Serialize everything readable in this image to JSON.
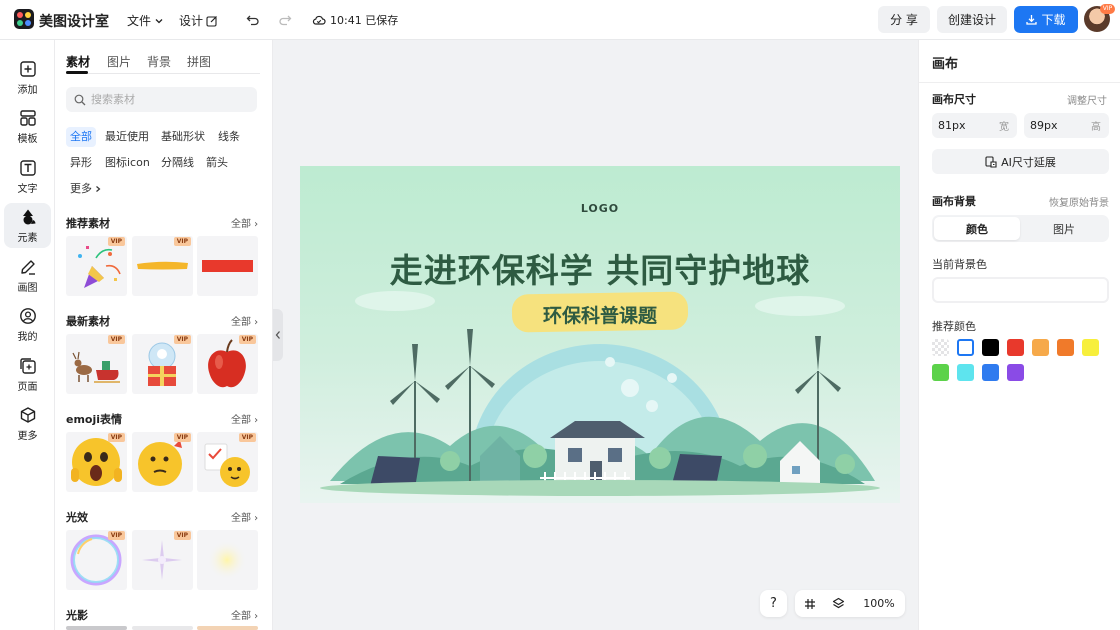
{
  "header": {
    "brand": "美图设计室",
    "menu_file": "文件",
    "menu_design": "设计",
    "save_time": "10:41 已保存",
    "share_label": "分 享",
    "create_label": "创建设计",
    "download_label": "下载",
    "avatar_badge": "VIP",
    "accent_color": "#1d77f3"
  },
  "rail": [
    {
      "label": "添加",
      "icon": "plus-square-icon"
    },
    {
      "label": "模板",
      "icon": "template-icon"
    },
    {
      "label": "文字",
      "icon": "text-icon"
    },
    {
      "label": "元素",
      "icon": "shapes-icon",
      "active": true
    },
    {
      "label": "画图",
      "icon": "draw-icon"
    },
    {
      "label": "我的",
      "icon": "user-icon"
    },
    {
      "label": "页面",
      "icon": "page-add-icon"
    },
    {
      "label": "更多",
      "icon": "cube-icon"
    }
  ],
  "panel": {
    "tabs": [
      "素材",
      "图片",
      "背景",
      "拼图"
    ],
    "active_tab": "素材",
    "search_placeholder": "搜索素材",
    "chips": [
      "全部",
      "最近使用",
      "基础形状",
      "线条",
      "异形",
      "图标icon",
      "分隔线",
      "箭头",
      "更多"
    ],
    "active_chip": "全部",
    "sections": [
      {
        "title": "推荐素材",
        "more": "全部"
      },
      {
        "title": "最新素材",
        "more": "全部"
      },
      {
        "title": "emoji表情",
        "more": "全部"
      },
      {
        "title": "光效",
        "more": "全部"
      },
      {
        "title": "光影",
        "more": "全部"
      }
    ],
    "vip_label": "VIP"
  },
  "canvas": {
    "logo_text": "LOGO",
    "title": "走进环保科学 共同守护地球",
    "subtitle": "环保科普课题",
    "zoom": "100%",
    "help": "?"
  },
  "props": {
    "title": "画布",
    "size_label": "画布尺寸",
    "resize_link": "调整尺寸",
    "width_value": "81px",
    "width_unit": "宽",
    "height_value": "89px",
    "height_unit": "高",
    "ai_extend": "AI尺寸延展",
    "bg_label": "画布背景",
    "restore_link": "恢复原始背景",
    "seg_color": "颜色",
    "seg_image": "图片",
    "current_bg_label": "当前背景色",
    "recommend_label": "推荐颜色",
    "swatches": [
      "transparent",
      "#ffffff",
      "#000000",
      "#e8392c",
      "#f6a94a",
      "#f07a2a",
      "#f7ef3c",
      "#5cd24a",
      "#5ee4ee",
      "#2f7bef",
      "#8a4be6"
    ]
  }
}
